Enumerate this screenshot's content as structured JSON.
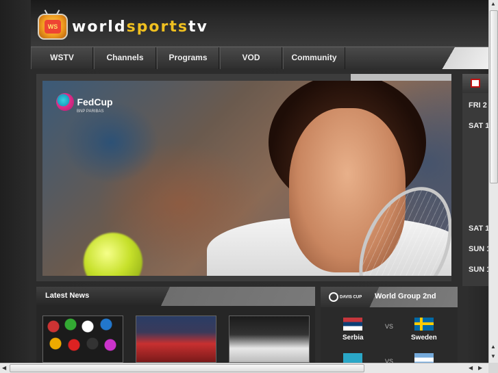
{
  "brand": {
    "text_w": "world",
    "text_s": "sports",
    "text_t": "tv",
    "logo_screen": "WS"
  },
  "nav": {
    "items": [
      "WSTV",
      "Channels",
      "Programs",
      "VOD",
      "Community"
    ]
  },
  "hero": {
    "logo_text": "FedCup",
    "logo_sub": "BNP PARIBAS"
  },
  "side_panel": {
    "dates": [
      "FRI 2",
      "SAT 1",
      "SAT 1",
      "SUN 1",
      "SUN 1"
    ]
  },
  "news": {
    "title": "Latest News"
  },
  "davis_cup": {
    "logo_text": "DAVIS CUP",
    "title": "World Group  2nd",
    "matches": [
      {
        "home": "Serbia",
        "away": "Sweden",
        "vs": "VS"
      },
      {
        "home": "",
        "away": "",
        "vs": "VS"
      }
    ]
  },
  "colors": {
    "accent": "#f0c020",
    "background": "#2c2c2c",
    "nav": "#3a3a3a"
  }
}
